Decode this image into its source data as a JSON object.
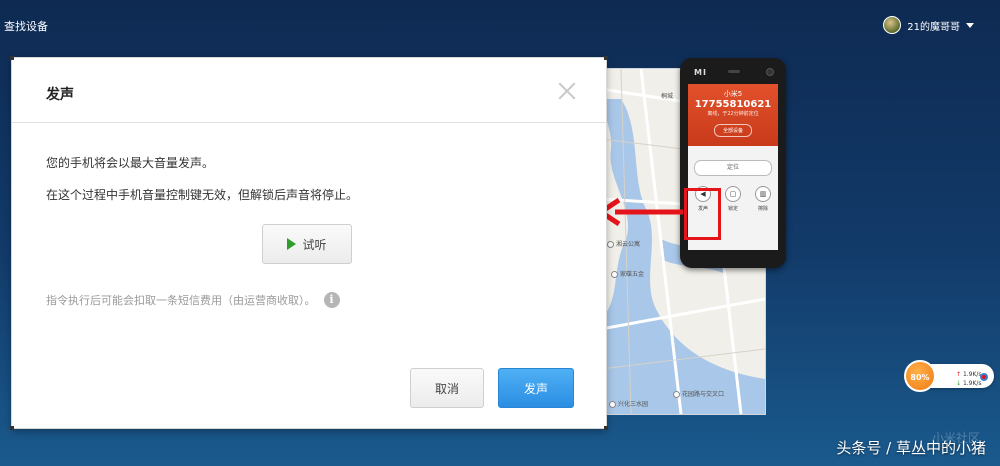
{
  "app": {
    "title": "查找设备"
  },
  "user": {
    "name": "21的魔哥哥"
  },
  "dialog": {
    "title": "发声",
    "message_1": "您的手机将会以最大音量发声。",
    "message_2": "在这个过程中手机音量控制键无效，但解锁后声音将停止。",
    "listen_label": "试听",
    "note": "指令执行后可能会扣取一条短信费用（由运营商收取）。",
    "cancel_label": "取消",
    "confirm_label": "发声"
  },
  "phone": {
    "brand": "MI",
    "device_name": "小米5",
    "number": "17755810621",
    "status": "离线，于22分钟前定位",
    "all_devices_label": "全部设备",
    "locate_label": "定位",
    "actions": [
      {
        "label": "发声",
        "icon": "speaker-icon"
      },
      {
        "label": "锁定",
        "icon": "lock-icon"
      },
      {
        "label": "擦除",
        "icon": "trash-icon"
      }
    ]
  },
  "map": {
    "labels": [
      "湘云公寓",
      "家碟五金",
      "兴化三水园",
      "花园路与交叉口",
      "桐城"
    ]
  },
  "speed_widget": {
    "percent": "80%",
    "upload": "1.9K/s",
    "download": "1.9K/s"
  },
  "watermark": {
    "text": "头条号 / 草丛中的小猪",
    "faint": "小米社区"
  },
  "colors": {
    "accent_blue": "#2b8ee2",
    "highlight_red": "#e5141b",
    "phone_header": "#d8461f"
  }
}
